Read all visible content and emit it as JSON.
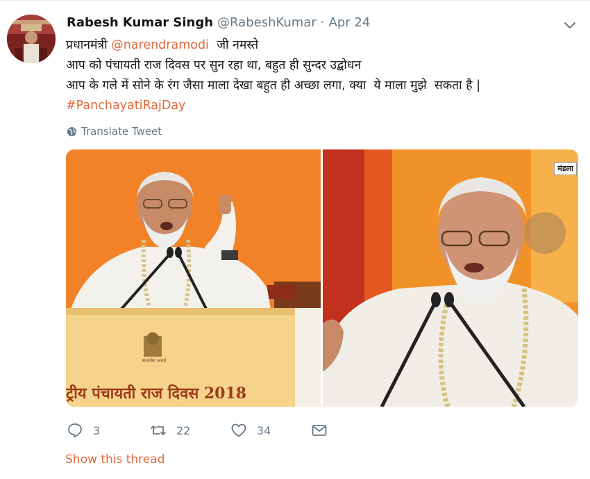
{
  "tweet": {
    "author_name": "Rabesh Kumar Singh",
    "handle": "@RabeshKumar",
    "separator": "·",
    "date": "Apr 24",
    "text_line1_prefix": "प्रधानमंत्री ",
    "mention": "@narendramodi",
    "text_line1_suffix": "  जी नमस्ते",
    "text_line2": "आप को पंचायती राज दिवस पर सुन रहा था, बहुत ही सुन्दर उद्बोधन",
    "text_line3": "आप के गले में सोने के रंग जैसा माला देखा बहुत ही अच्छा लगा, क्या  ये माला मुझे  सकता है |",
    "hashtag": "#PanchayatiRajDay",
    "translate_label": "Translate Tweet",
    "media": {
      "left_banner_text": "ट्रीय पंचायती राज दिवस 2018",
      "left_emblem_caption": "सत्यमेव जयते",
      "right_watermark": "मंडला"
    },
    "actions": {
      "replies": "3",
      "retweets": "22",
      "likes": "34"
    },
    "show_thread": "Show this thread"
  },
  "colors": {
    "link": "#e0693a",
    "secondary_text": "#657786",
    "primary_text": "#14171a"
  },
  "icons": [
    "avatar",
    "chevron-down-icon",
    "globe-icon",
    "reply-icon",
    "retweet-icon",
    "heart-icon",
    "envelope-icon"
  ]
}
